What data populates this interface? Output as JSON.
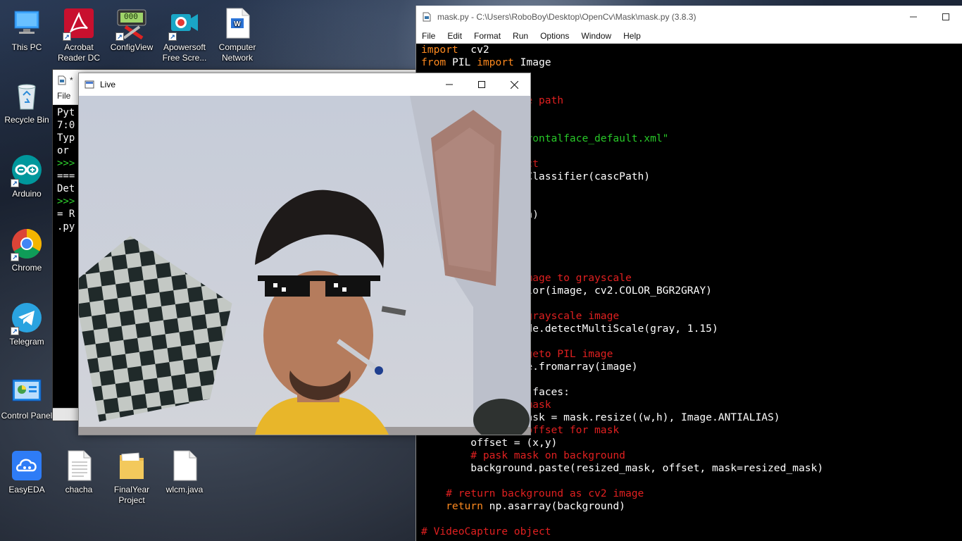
{
  "desktop": {
    "icons": [
      {
        "label": "This PC"
      },
      {
        "label": "Acrobat Reader DC"
      },
      {
        "label": "ConfigView"
      },
      {
        "label": "Apowersoft Free Scre..."
      },
      {
        "label": "Computer Network"
      },
      {
        "label": "Recycle Bin"
      },
      {
        "label": "Arduino"
      },
      {
        "label": "Chrome"
      },
      {
        "label": "Telegram"
      },
      {
        "label": "Control Panel"
      },
      {
        "label": "EasyEDA"
      },
      {
        "label": "chacha"
      },
      {
        "label": "FinalYear Project"
      },
      {
        "label": "wlcm.java"
      }
    ],
    "configview_display": "000"
  },
  "shell": {
    "title": "*",
    "menu_file": "File",
    "lines": [
      "Pyt",
      "7:0",
      "Typ",
      "or ",
      ">>>",
      "===",
      "Det",
      ">>>",
      "= R",
      ".py"
    ]
  },
  "editor": {
    "title": "mask.py - C:\\Users\\RoboBoy\\Desktop\\OpenCv\\Mask\\mask.py (3.8.3)",
    "menu": [
      "File",
      "Edit",
      "Format",
      "Run",
      "Options",
      "Window",
      "Help"
    ],
    "colors": {
      "keyword": "#ff8a1f",
      "comment": "#e02020",
      "string": "#28c828",
      "background": "#000000"
    }
  },
  "live": {
    "title": "Live",
    "scene": "webcam feed with pixel sunglasses and cigarette overlay"
  }
}
